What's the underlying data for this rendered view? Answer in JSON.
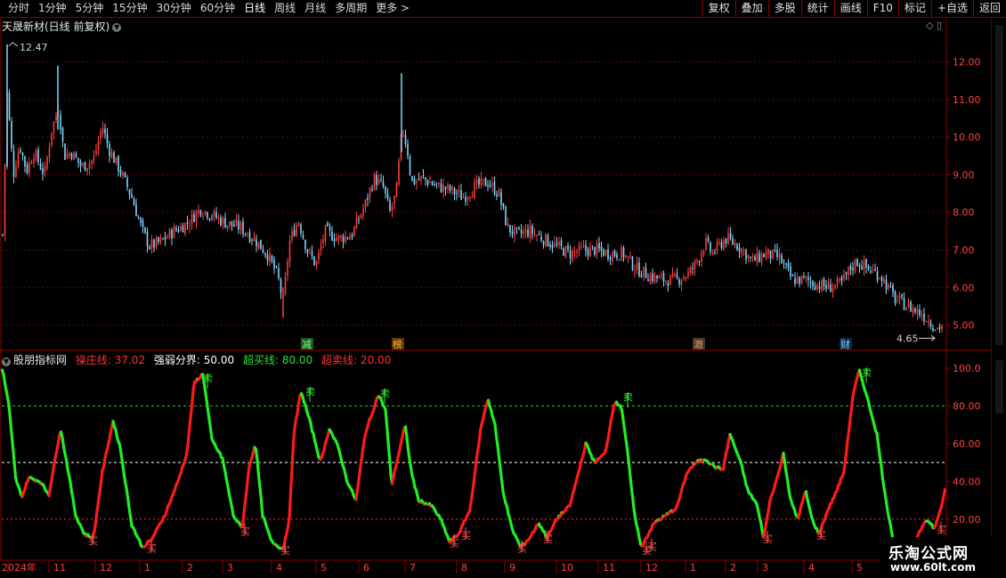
{
  "toolbar": {
    "periods": [
      "分时",
      "1分钟",
      "5分钟",
      "15分钟",
      "30分钟",
      "60分钟",
      "日线",
      "周线",
      "月线",
      "多周期",
      "更多 >"
    ],
    "active_period": "日线",
    "right_buttons": [
      "复权",
      "叠加",
      "多股",
      "统计",
      "画线",
      "F10",
      "标记",
      "+自选",
      "返回"
    ]
  },
  "main_chart": {
    "title": "天晟新材(日线 前复权)",
    "y_ticks": [
      "12.00",
      "11.00",
      "10.00",
      "9.00",
      "8.00",
      "7.00",
      "6.00",
      "5.00"
    ],
    "high_label": "12.47",
    "low_label": "4.65",
    "event_markers": [
      "减",
      "榜",
      "澈",
      "财"
    ]
  },
  "indicator": {
    "name": "股朋指标网",
    "params": [
      {
        "label": "操庄线:",
        "value": "37.02",
        "color": "#ff3030"
      },
      {
        "label": "强弱分界:",
        "value": "50.00",
        "color": "#ffffff"
      },
      {
        "label": "超买线:",
        "value": "80.00",
        "color": "#33dd33"
      },
      {
        "label": "超卖线:",
        "value": "20.00",
        "color": "#ff3030"
      }
    ],
    "y_ticks": [
      "100.0",
      "80.00",
      "60.00",
      "40.00",
      "20.00"
    ],
    "buy_label": "买",
    "sell_label": "卖"
  },
  "time_axis": [
    "2024年",
    "11",
    "12",
    "1",
    "2",
    "3",
    "4",
    "5",
    "6",
    "7",
    "8",
    "9",
    "10",
    "11",
    "12",
    "1",
    "2",
    "3",
    "4",
    "5"
  ],
  "watermark": {
    "title": "乐淘公式网",
    "url": "www.60lt.com"
  },
  "colors": {
    "up": "#ff3b3b",
    "down": "#7fd8ff",
    "grid": "#6a0000",
    "frame": "#8a0000",
    "osc_up": "#ff1a1a",
    "osc_down": "#22ee22"
  }
}
